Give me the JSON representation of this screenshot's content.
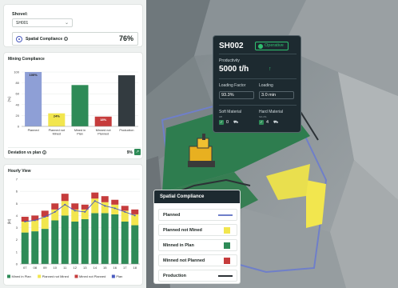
{
  "shovel": {
    "title": "Shovel:",
    "selected": "SH001",
    "spatial_compliance_label": "Spatial Compliance",
    "spatial_compliance_value": "76%"
  },
  "mining_compliance": {
    "title": "Mining Compliance",
    "deviation_label": "Deviation vs plan",
    "deviation_value": "9%"
  },
  "hourly_view": {
    "title": "Hourly View"
  },
  "chart_data": [
    {
      "type": "bar",
      "title": "Mining Compliance",
      "ylabel": "(%)",
      "ylim": [
        0,
        100
      ],
      "yticks": [
        0,
        20,
        40,
        60,
        80,
        100
      ],
      "categories": [
        "Planned",
        "Planned not Mined",
        "Mined in Plan",
        "Minned not Planned",
        "Production"
      ],
      "values": [
        100,
        24,
        76,
        18,
        94
      ],
      "data_labels": [
        "100%",
        "24%",
        "",
        "18%",
        ""
      ],
      "colors": [
        "#8e9fd6",
        "#f2e64e",
        "#2e8b57",
        "#c63c3c",
        "#333b40"
      ]
    },
    {
      "type": "bar",
      "title": "Hourly View",
      "ylabel": "(kt)",
      "ylim": [
        0,
        7
      ],
      "yticks": [
        0,
        1,
        2,
        3,
        4,
        5,
        6,
        7
      ],
      "categories": [
        "07",
        "08",
        "09",
        "10",
        "11",
        "12",
        "13",
        "14",
        "15",
        "16",
        "17",
        "18"
      ],
      "series": [
        {
          "name": "Mined in Plan",
          "color": "#2e8b57",
          "values": [
            2.6,
            2.7,
            2.9,
            3.6,
            4.0,
            3.5,
            3.7,
            4.2,
            4.2,
            4.1,
            3.5,
            3.2
          ]
        },
        {
          "name": "Planned not Mined",
          "color": "#f2e64e",
          "values": [
            0.9,
            0.9,
            1.0,
            0.9,
            1.2,
            1.0,
            0.8,
            1.2,
            0.9,
            0.8,
            0.9,
            0.9
          ]
        },
        {
          "name": "Mined not Planned",
          "color": "#c63c3c",
          "values": [
            0.4,
            0.4,
            0.5,
            0.5,
            0.6,
            0.5,
            0.4,
            0.5,
            0.5,
            0.4,
            0.4,
            0.4
          ]
        }
      ],
      "line": {
        "name": "Plan",
        "color": "#4a5bbf",
        "values": [
          3.5,
          3.6,
          3.9,
          4.3,
          4.9,
          4.4,
          4.3,
          5.2,
          4.8,
          4.6,
          4.3,
          4.0
        ]
      },
      "legend_position": "bottom"
    }
  ],
  "tooltip": {
    "id": "SH002",
    "status": "Operative",
    "productivity_label": "Productivity",
    "productivity_value": "5000 t/h",
    "loading_factor_label": "Loading Factor",
    "loading_factor_value": "93.3%",
    "loading_label": "Loading",
    "loading_value": "3.0 min",
    "soft_label": "Soft Material",
    "soft_sub": "Off",
    "soft_count": "0",
    "hard_label": "Hard Material",
    "hard_sub": "SO-XS",
    "hard_count": "4"
  },
  "spatial_legend": {
    "title": "Spatial Compliance",
    "items": [
      {
        "label": "Planned",
        "color": "#6f7fc9",
        "kind": "line"
      },
      {
        "label": "Planned not Mined",
        "color": "#f2e64e",
        "kind": "square"
      },
      {
        "label": "Minned in Plan",
        "color": "#2e8b57",
        "kind": "square"
      },
      {
        "label": "Minned not Planned",
        "color": "#c63c3c",
        "kind": "square"
      },
      {
        "label": "Production",
        "color": "#2c3236",
        "kind": "line"
      }
    ]
  }
}
